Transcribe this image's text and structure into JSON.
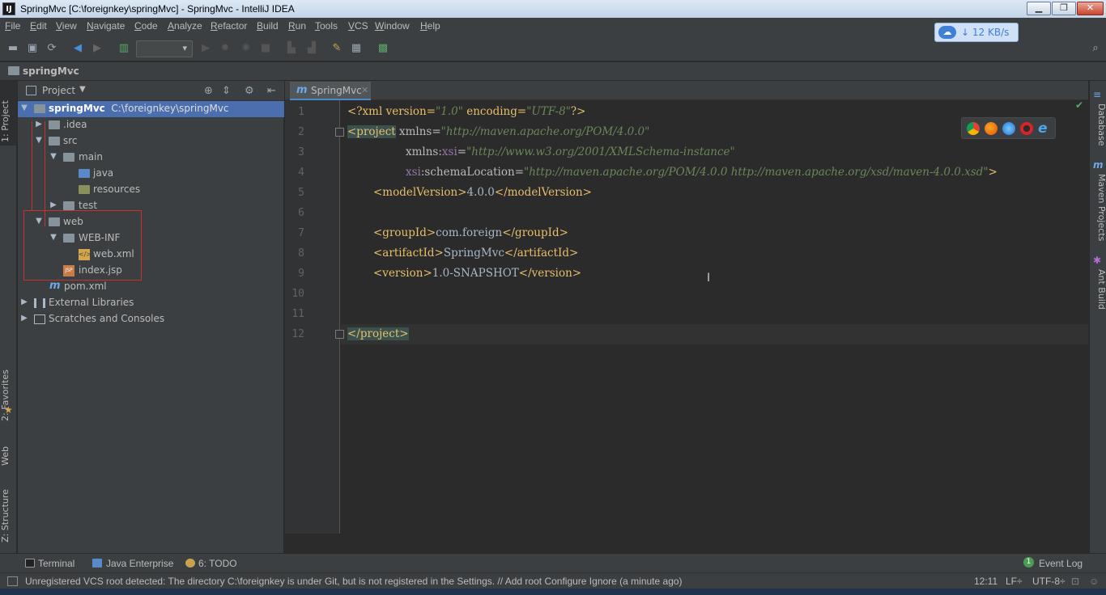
{
  "window": {
    "title": "SpringMvc [C:\\foreignkey\\springMvc] - SpringMvc - IntelliJ IDEA",
    "app_icon": "IJ"
  },
  "menu": [
    "File",
    "Edit",
    "View",
    "Navigate",
    "Code",
    "Analyze",
    "Refactor",
    "Build",
    "Run",
    "Tools",
    "VCS",
    "Window",
    "Help"
  ],
  "net_badge": {
    "speed": "12 KB/s",
    "arrow": "↓"
  },
  "navbar": {
    "crumb": "springMvc"
  },
  "left_tabs": {
    "project": "1: Project",
    "favorites": "2: Favorites",
    "web": "Web",
    "structure": "Z: Structure"
  },
  "project_panel": {
    "title": "Project",
    "tree": [
      {
        "name": "springMvc",
        "path": "C:\\foreignkey\\springMvc"
      },
      {
        "name": ".idea"
      },
      {
        "name": "src"
      },
      {
        "name": "main"
      },
      {
        "name": "java"
      },
      {
        "name": "resources"
      },
      {
        "name": "test"
      },
      {
        "name": "web"
      },
      {
        "name": "WEB-INF"
      },
      {
        "name": "web.xml"
      },
      {
        "name": "index.jsp"
      },
      {
        "name": "pom.xml"
      },
      {
        "name": "External Libraries"
      },
      {
        "name": "Scratches and Consoles"
      }
    ]
  },
  "editor": {
    "tab": "SpringMvc",
    "line_numbers": [
      "1",
      "2",
      "3",
      "4",
      "5",
      "6",
      "7",
      "8",
      "9",
      "10",
      "11",
      "12"
    ],
    "code": {
      "l1_a": "<?xml version=",
      "l1_v1": "\"1.0\"",
      "l1_b": " encoding=",
      "l1_v2": "\"UTF-8\"",
      "l1_c": "?>",
      "l2_tag": "<project",
      "l2_attr": " xmlns=",
      "l2_val": "\"http://maven.apache.org/POM/4.0.0\"",
      "l3_attr": "xmlns:",
      "l3_ns": "xsi",
      "l3_eq": "=",
      "l3_val": "\"http://www.w3.org/2001/XMLSchema-instance\"",
      "l4_ns": "xsi",
      "l4_attr": ":schemaLocation=",
      "l4_val": "\"http://maven.apache.org/POM/4.0.0 http://maven.apache.org/xsd/maven-4.0.0.xsd\"",
      "l4_end": ">",
      "l5_open": "<modelVersion>",
      "l5_text": "4.0.0",
      "l5_close": "</modelVersion>",
      "l7_open": "<groupId>",
      "l7_text": "com.foreign",
      "l7_close": "</groupId>",
      "l8_open": "<artifactId>",
      "l8_text": "SpringMvc",
      "l8_close": "</artifactId>",
      "l9_open": "<version>",
      "l9_text": "1.0-SNAPSHOT",
      "l9_close": "</version>",
      "l12_close": "</project>"
    }
  },
  "right_tabs": {
    "database": "Database",
    "maven": "Maven Projects",
    "ant": "Ant Build"
  },
  "tool_windows": {
    "terminal": "Terminal",
    "java_enterprise": "Java Enterprise",
    "todo": "6: TODO",
    "event_log": "Event Log",
    "event_count": "1"
  },
  "status": {
    "message": "Unregistered VCS root detected: The directory C:\\foreignkey is under Git, but is not registered in the Settings. // Add root  Configure  Ignore (a minute ago)",
    "position": "12:11",
    "line_sep": "LF÷",
    "encoding": "UTF-8÷"
  },
  "colors": {
    "selection": "#4b6eaf",
    "highlight_box": "#c93030",
    "tag": "#e8bf6a",
    "string": "#6a8759"
  }
}
